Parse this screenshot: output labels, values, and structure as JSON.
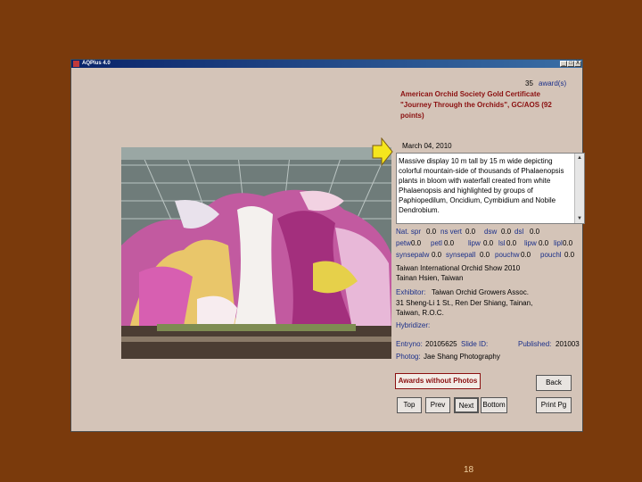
{
  "window": {
    "title": "AQPlus 4.0",
    "controls": [
      "_",
      "□",
      "X"
    ]
  },
  "record": {
    "award_count": "35",
    "award_suffix": "award(s)",
    "award_line1": "American Orchid Society Gold Certificate",
    "award_line2": "\"Journey Through the Orchids\", GC/AOS (92",
    "award_line3": "points)",
    "date": "March 04, 2010",
    "description": "Massive display 10 m tall by 15 m wide depicting colorful mountain-side of thousands of Phalaenopsis plants in bloom with waterfall created from white Phalaenopsis and highlighted by groups of Paphiopedilum, Oncidium, Cymbidium and Nobile Dendrobium."
  },
  "measurements": [
    {
      "label": "Nat. spr",
      "value": "0.0"
    },
    {
      "label": "ns vert",
      "value": "0.0"
    },
    {
      "label": "dsw",
      "value": "0.0"
    },
    {
      "label": "dsl",
      "value": "0.0"
    },
    {
      "label": "petw",
      "value": "0.0"
    },
    {
      "label": "petl",
      "value": "0.0"
    },
    {
      "label": "lipw",
      "value": "0.0"
    },
    {
      "label": "lsl",
      "value": "0.0"
    },
    {
      "label": "lipw",
      "value": "0.0"
    },
    {
      "label": "lipl",
      "value": "0.0"
    },
    {
      "label": "synsepalw",
      "value": "0.0"
    },
    {
      "label": "synsepall",
      "value": "0.0"
    },
    {
      "label": "pouchw",
      "value": "0.0"
    },
    {
      "label": "pouchl",
      "value": "0.0"
    }
  ],
  "show": {
    "line1": "Taiwan International Orchid Show 2010",
    "line2": "Tainan Hsien, Taiwan"
  },
  "exhibitor": {
    "label": "Exhibitor:",
    "name": "Taiwan Orchid Growers Assoc.",
    "address1": "31 Sheng-Li 1 St., Ren Der Shiang, Tainan,",
    "address2": "Taiwan, R.O.C."
  },
  "hybridizer": {
    "label": "Hybridizer:",
    "value": ""
  },
  "entry": {
    "entryno_label": "Entryno:",
    "entryno": "20105625",
    "slide_label": "Slide ID:",
    "slide_id": "",
    "published_label": "Published:",
    "published": "201003"
  },
  "photog": {
    "label": "Photog:",
    "value": "Jae Shang Photography"
  },
  "buttons": {
    "awards_without_photos": "Awards without Photos",
    "back": "Back",
    "top": "Top",
    "prev": "Prev",
    "next": "Next",
    "bottom": "Bottom",
    "print_pg": "Print Pg"
  },
  "slide_number": "18",
  "colors": {
    "background": "#7a3a0c",
    "window": "#d4c4b8",
    "label_red": "#8b1010",
    "label_blue": "#1a2f8a",
    "arrow_fill": "#f5e61e"
  }
}
